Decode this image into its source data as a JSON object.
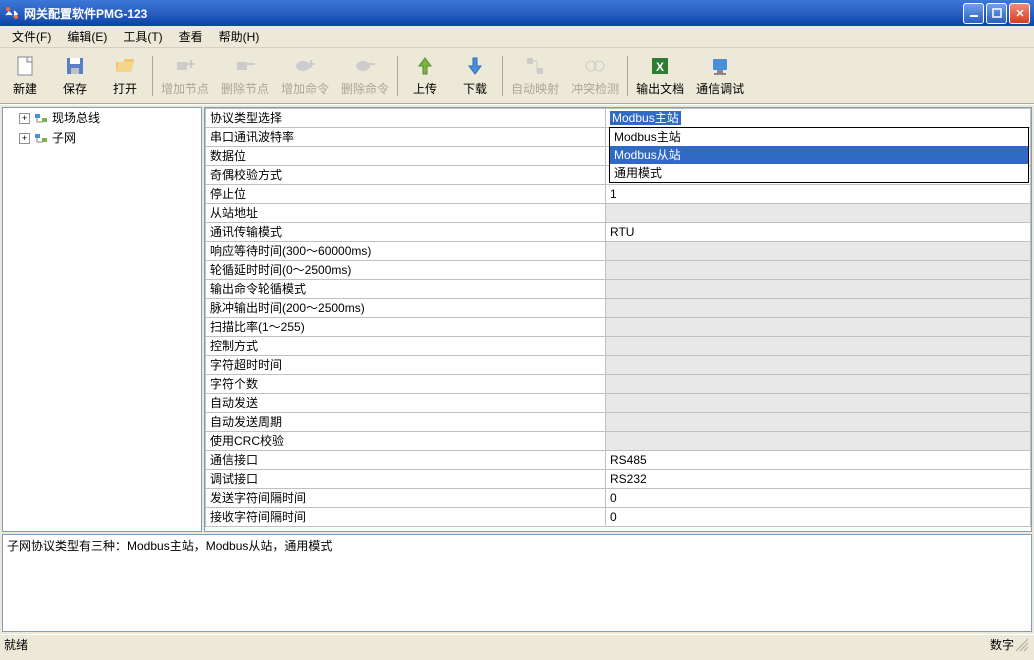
{
  "window": {
    "title": "网关配置软件PMG-123"
  },
  "menubar": {
    "items": [
      {
        "label": "文件(F)"
      },
      {
        "label": "编辑(E)"
      },
      {
        "label": "工具(T)"
      },
      {
        "label": "查看"
      },
      {
        "label": "帮助(H)"
      }
    ]
  },
  "toolbar": {
    "items": [
      {
        "label": "新建",
        "icon": "new",
        "disabled": false
      },
      {
        "label": "保存",
        "icon": "save",
        "disabled": false
      },
      {
        "label": "打开",
        "icon": "open",
        "disabled": false
      },
      {
        "sep": true
      },
      {
        "label": "增加节点",
        "icon": "add-node",
        "disabled": true
      },
      {
        "label": "删除节点",
        "icon": "del-node",
        "disabled": true
      },
      {
        "label": "增加命令",
        "icon": "add-cmd",
        "disabled": true
      },
      {
        "label": "删除命令",
        "icon": "del-cmd",
        "disabled": true
      },
      {
        "sep": true
      },
      {
        "label": "上传",
        "icon": "upload",
        "disabled": false
      },
      {
        "label": "下载",
        "icon": "download",
        "disabled": false
      },
      {
        "sep": true
      },
      {
        "label": "自动映射",
        "icon": "auto-map",
        "disabled": true
      },
      {
        "label": "冲突检测",
        "icon": "conflict",
        "disabled": true
      },
      {
        "sep": true
      },
      {
        "label": "输出文档",
        "icon": "excel",
        "disabled": false
      },
      {
        "label": "通信调试",
        "icon": "debug",
        "disabled": false
      }
    ]
  },
  "tree": {
    "nodes": [
      {
        "label": "现场总线",
        "expandable": true
      },
      {
        "label": "子网",
        "expandable": true
      }
    ]
  },
  "grid": {
    "dropdown": {
      "options": [
        "Modbus主站",
        "Modbus从站",
        "通用模式"
      ],
      "highlighted": 1
    },
    "rows": [
      {
        "label": "协议类型选择",
        "value": "Modbus主站",
        "selected": true,
        "grey": false
      },
      {
        "label": "串口通讯波特率",
        "value": "",
        "grey": false,
        "covered": true
      },
      {
        "label": "数据位",
        "value": "",
        "grey": false,
        "covered": true
      },
      {
        "label": "奇偶校验方式",
        "value": "",
        "grey": false,
        "covered": true
      },
      {
        "label": "停止位",
        "value": "1",
        "grey": false
      },
      {
        "label": "从站地址",
        "value": "",
        "grey": true
      },
      {
        "label": "通讯传输模式",
        "value": "RTU",
        "grey": false
      },
      {
        "label": "响应等待时间(300～60000ms)",
        "value": "",
        "grey": true
      },
      {
        "label": "轮循延时时间(0～2500ms)",
        "value": "",
        "grey": true
      },
      {
        "label": "输出命令轮循模式",
        "value": "",
        "grey": true
      },
      {
        "label": "脉冲输出时间(200～2500ms)",
        "value": "",
        "grey": true
      },
      {
        "label": "扫描比率(1～255)",
        "value": "",
        "grey": true
      },
      {
        "label": "控制方式",
        "value": "",
        "grey": true
      },
      {
        "label": "字符超时时间",
        "value": "",
        "grey": true
      },
      {
        "label": "字符个数",
        "value": "",
        "grey": true
      },
      {
        "label": "自动发送",
        "value": "",
        "grey": true
      },
      {
        "label": "自动发送周期",
        "value": "",
        "grey": true
      },
      {
        "label": "使用CRC校验",
        "value": "",
        "grey": true
      },
      {
        "label": "通信接口",
        "value": "RS485",
        "grey": false
      },
      {
        "label": "调试接口",
        "value": "RS232",
        "grey": false
      },
      {
        "label": "发送字符间隔时间",
        "value": "0",
        "grey": false
      },
      {
        "label": "接收字符间隔时间",
        "value": "0",
        "grey": false
      }
    ]
  },
  "info": {
    "text": "子网协议类型有三种：Modbus主站，Modbus从站，通用模式"
  },
  "statusbar": {
    "ready": "就绪",
    "right": "数字"
  },
  "icons": {
    "tools_svg": "<svg viewBox='0 0 16 16'><path fill='#fff' d='M2 2l4 4-2 2-4-4zM14 14l-4-4 2-2 4 4z'/></svg>"
  }
}
